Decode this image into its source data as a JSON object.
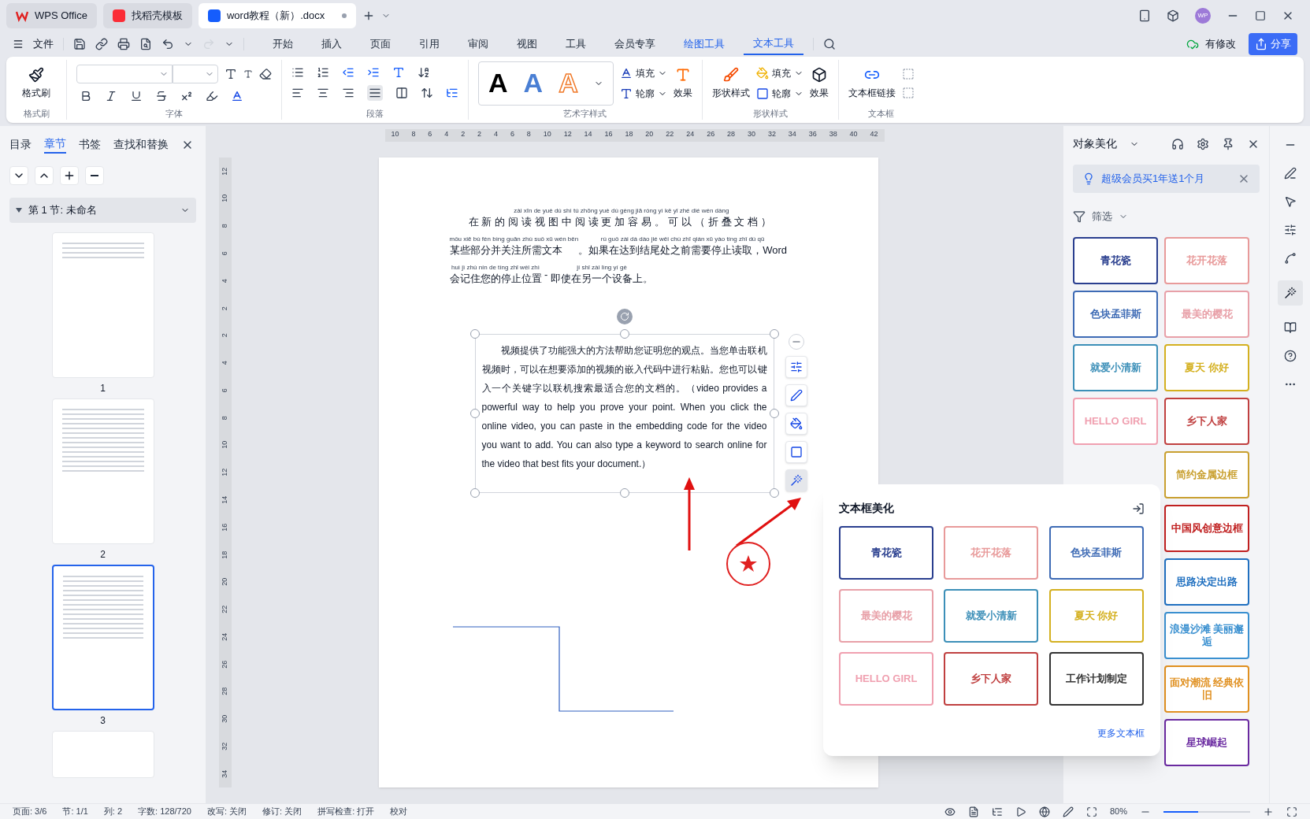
{
  "tabs": [
    {
      "label": "WPS Office",
      "kind": "home",
      "selected": false
    },
    {
      "label": "找稻壳模板",
      "kind": "template",
      "selected": false
    },
    {
      "label": "word教程（新）.docx",
      "kind": "doc",
      "selected": true
    }
  ],
  "window": {
    "avatar": "WP"
  },
  "menu": {
    "file": "文件",
    "items": [
      {
        "label": "开始",
        "kind": "normal",
        "selected": false
      },
      {
        "label": "插入",
        "kind": "normal",
        "selected": false
      },
      {
        "label": "页面",
        "kind": "normal",
        "selected": false
      },
      {
        "label": "引用",
        "kind": "normal",
        "selected": false
      },
      {
        "label": "审阅",
        "kind": "normal",
        "selected": false
      },
      {
        "label": "视图",
        "kind": "normal",
        "selected": false
      },
      {
        "label": "工具",
        "kind": "normal",
        "selected": false
      },
      {
        "label": "会员专享",
        "kind": "normal",
        "selected": false
      },
      {
        "label": "绘图工具",
        "kind": "context",
        "selected": false
      },
      {
        "label": "文本工具",
        "kind": "context",
        "selected": true
      }
    ],
    "modified": "有修改",
    "share": "分享"
  },
  "ribbon": {
    "groups": [
      {
        "label": "格式刷",
        "kind": "brush",
        "buttons": [
          "格式刷"
        ]
      },
      {
        "label": "字体",
        "kind": "font"
      },
      {
        "label": "段落",
        "kind": "para"
      },
      {
        "label": "艺术字样式",
        "kind": "art",
        "previews": [
          "A",
          "A",
          "A"
        ],
        "buttons": [
          "填充",
          "轮廓",
          "效果"
        ]
      },
      {
        "label": "形状样式",
        "kind": "shape",
        "buttons": [
          "形状样式",
          "填充",
          "轮廓",
          "效果"
        ]
      },
      {
        "label": "文本框",
        "kind": "textbox",
        "buttons": [
          "文本框链接"
        ]
      }
    ]
  },
  "nav": {
    "tabs": [
      {
        "label": "目录",
        "selected": false
      },
      {
        "label": "章节",
        "selected": true
      },
      {
        "label": "书签",
        "selected": false
      },
      {
        "label": "查找和替换",
        "selected": false
      }
    ],
    "section": "第 1 节: 未命名",
    "pages": [
      {
        "number": "1",
        "selected": false
      },
      {
        "number": "2",
        "selected": false
      },
      {
        "number": "3",
        "selected": true
      }
    ]
  },
  "ruler": {
    "h": [
      "10",
      "8",
      "6",
      "4",
      "2",
      "2",
      "4",
      "6",
      "8",
      "10",
      "12",
      "14",
      "16",
      "18",
      "20",
      "22",
      "24",
      "26",
      "28",
      "30",
      "32",
      "34",
      "36",
      "38",
      "40",
      "42"
    ],
    "v": [
      "12",
      "10",
      "8",
      "6",
      "4",
      "2",
      "2",
      "4",
      "6",
      "8",
      "10",
      "12",
      "14",
      "16",
      "18",
      "20",
      "22",
      "24",
      "26",
      "28",
      "30",
      "32",
      "34"
    ]
  },
  "document": {
    "lines": [
      [
        {
          "t": "在新的阅读视图中阅读更加容易。可以（折叠文档）",
          "p": "zài xīn de yuè dú shì tú zhōng yuè dú gèng jiā róng yì kě yǐ zhé dié wén dàng"
        }
      ],
      [
        {
          "t": "某些部分并关注所需文本",
          "p": "mǒu xiē bù fèn bìng guān zhù suǒ xū wén běn"
        },
        {
          "t": "。如果在达到结尾处之前需要停止读取，Word",
          "p": "rú guǒ zài dá dào jié wěi chù zhī qián xū yào tíng zhǐ dú qǔ"
        }
      ],
      [
        {
          "t": "会记住您的停止位置",
          "p": "huì jì zhù nín de tíng zhǐ wèi zhì"
        },
        {
          "t": " - "
        },
        {
          "t": "即使在另一个设备上。",
          "p": "jí shǐ zài lìng yí gè"
        }
      ]
    ],
    "textbox": "视频提供了功能强大的方法帮助您证明您的观点。当您单击联机视频时，可以在想要添加的视频的嵌入代码中进行粘贴。您也可以键入一个关键字以联机搜索最适合您的文档的。（video provides a powerful way to help you prove your point. When you click the online video, you can paste in the embedding code for the video you want to add. You can also type a keyword to search online for the video that best fits your document.）"
  },
  "popup": {
    "title": "文本框美化",
    "more": "更多文本框",
    "items": [
      {
        "title": "青花瓷",
        "color": "#2a3f8f"
      },
      {
        "title": "花开花落",
        "color": "#e89a9a"
      },
      {
        "title": "色块孟菲斯",
        "color": "#3e6bb5"
      },
      {
        "title": "最美的樱花",
        "color": "#e8a0a8"
      },
      {
        "title": "就爱小清新",
        "color": "#3c8fb8"
      },
      {
        "title": "夏天 你好",
        "color": "#d4b020"
      },
      {
        "title": "HELLO GIRL",
        "color": "#f0a0b0"
      },
      {
        "title": "乡下人家",
        "color": "#c04040"
      },
      {
        "title": "工作计划制定",
        "color": "#333333"
      }
    ]
  },
  "panel": {
    "title": "对象美化",
    "promo": "超级会员买1年送1个月",
    "filter": "筛选",
    "left": [
      {
        "title": "青花瓷",
        "color": "#2a3f8f"
      },
      {
        "title": "色块孟菲斯",
        "color": "#3e6bb5"
      },
      {
        "title": "就爱小清新",
        "color": "#3c8fb8"
      },
      {
        "title": "HELLO GIRL",
        "color": "#f0a0b0"
      }
    ],
    "right": [
      {
        "title": "花开花落",
        "color": "#e89a9a"
      },
      {
        "title": "最美的樱花",
        "color": "#e8a0a8"
      },
      {
        "title": "夏天 你好",
        "color": "#d4b020"
      },
      {
        "title": "乡下人家",
        "color": "#c04040"
      },
      {
        "title": "简约金属边框",
        "color": "#c9a030"
      },
      {
        "title": "中国风创意边框",
        "color": "#c02020"
      },
      {
        "title": "思路决定出路",
        "color": "#2070c0"
      },
      {
        "title": "浪漫沙滩 美丽邂逅",
        "color": "#3a90d0"
      },
      {
        "title": "面对潮流 经典依旧",
        "color": "#e09020"
      },
      {
        "title": "星球崛起",
        "color": "#6a2aa0"
      }
    ]
  },
  "status": {
    "items": [
      "页面: 3/6",
      "节: 1/1",
      "列: 2",
      "字数: 128/720",
      "改写: 关闭",
      "修订: 关闭",
      "拼写检查: 打开",
      "校对"
    ],
    "zoom": "80%",
    "level": 0.4
  }
}
